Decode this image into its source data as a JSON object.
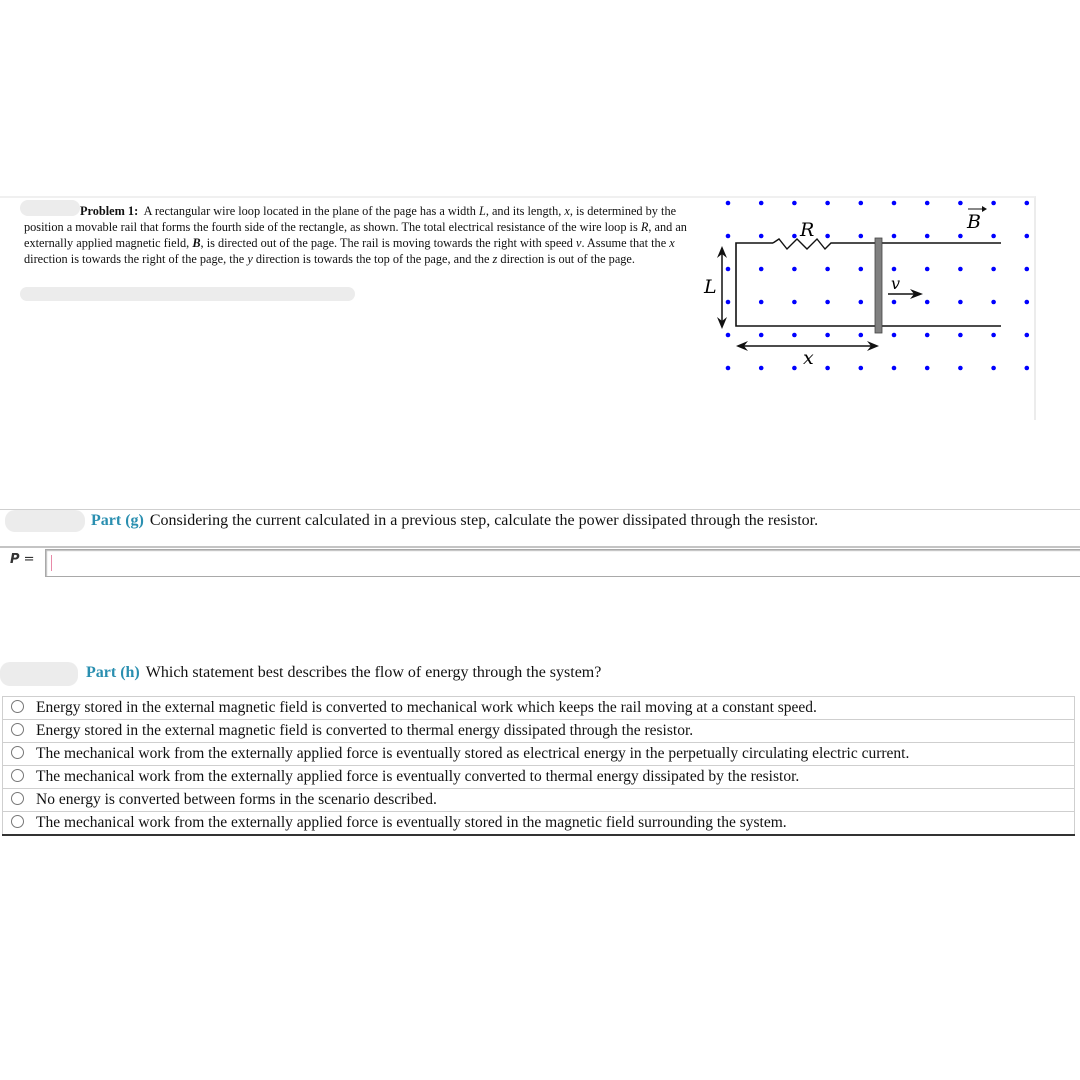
{
  "problem": {
    "title": "Problem 1:",
    "text_parts": {
      "p1": "A rectangular wire loop located in the plane of the page has a width ",
      "L": "L",
      "p2": ", and its length, ",
      "x": "x",
      "p3": ", is determined by the position a movable rail that forms the fourth side of the rectangle, as shown. The total electrical resistance of the wire loop is ",
      "R": "R",
      "p4": ", and an externally applied magnetic field, ",
      "B": "B",
      "p5": ", is directed out of the page. The rail is moving towards the right with speed ",
      "v": "v",
      "p6": ". Assume that the ",
      "x2": "x",
      "p7": " direction is towards the right of the page, the ",
      "y": "y",
      "p8": " direction is towards the top of the page, and the ",
      "z": "z",
      "p9": " direction is out of the page."
    }
  },
  "figure": {
    "labels": {
      "resistor": "R",
      "field": "B",
      "width": "L",
      "length": "x",
      "velocity": "v"
    },
    "colors": {
      "field_dots": "#0000ff",
      "rail": "#808080",
      "wire": "#111111"
    }
  },
  "part_g": {
    "label": "Part (g)",
    "question": "Considering the current calculated in a previous step, calculate the power dissipated through the resistor.",
    "input_label_var": "P",
    "input_label_eq": " =",
    "input_value": ""
  },
  "part_h": {
    "label": "Part (h)",
    "question": "Which statement best describes the flow of energy through the system?",
    "options": [
      "Energy stored in the external magnetic field is converted to mechanical work which keeps the rail moving at a constant speed.",
      "Energy stored in the external magnetic field is converted to thermal energy dissipated through the resistor.",
      "The mechanical work from the externally applied force is eventually stored as electrical energy in the perpetually circulating electric current.",
      "The mechanical work from the externally applied force is eventually converted to thermal energy dissipated by the resistor.",
      "No energy is converted between forms in the scenario described.",
      "The mechanical work from the externally applied force is eventually stored in the magnetic field surrounding the system."
    ]
  },
  "colors": {
    "part_label": "#2a8fb0"
  }
}
